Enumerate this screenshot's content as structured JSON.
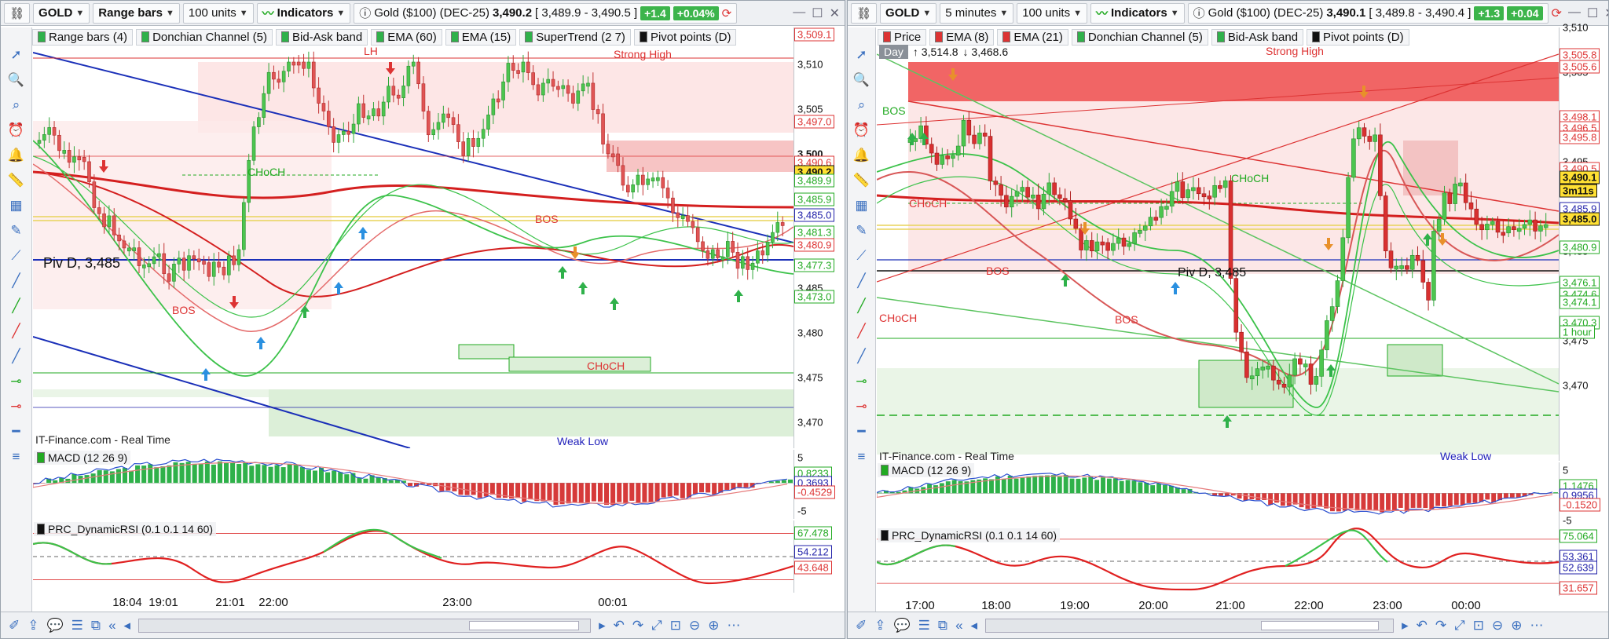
{
  "left": {
    "toolbar": {
      "symbol": "GOLD",
      "chart_type": "Range bars",
      "units": "100 units",
      "indicators_label": "Indicators",
      "instrument": "Gold ($100) (DEC-25)",
      "last": "3,490.2",
      "bidask": "[ 3,489.9 - 3,490.5 ]",
      "change": "+1.4",
      "change_pct": "+0.04%"
    },
    "legend": [
      {
        "label": "Range bars (4)",
        "color": "#2fb14a"
      },
      {
        "label": "Donchian Channel (5)",
        "color": "#2fb14a"
      },
      {
        "label": "Bid-Ask band",
        "color": "#2fb14a"
      },
      {
        "label": "EMA (60)",
        "color": "#2fb14a"
      },
      {
        "label": "EMA (15)",
        "color": "#2fb14a"
      },
      {
        "label": "SuperTrend (2 7)",
        "color": "#2fb14a"
      },
      {
        "label": "Pivot points (D)",
        "color": "#111111"
      }
    ],
    "price_axis": [
      "3,510",
      "3,505",
      "3,500",
      "3,495",
      "3,490",
      "3,485",
      "3,480",
      "3,475",
      "3,470"
    ],
    "price_tags": [
      {
        "text": "3,509.1",
        "color": "#d33"
      },
      {
        "text": "3,497.0",
        "color": "#d33"
      },
      {
        "text": "3,490.6",
        "color": "#d33"
      },
      {
        "text": "3,490.2",
        "color": "#111"
      },
      {
        "text": "3,489.9",
        "color": "#2a2"
      },
      {
        "text": "3,485.9",
        "color": "#2a2"
      },
      {
        "text": "3,485.0",
        "color": "#22a"
      },
      {
        "text": "3,481.3",
        "color": "#2a2"
      },
      {
        "text": "3,480.9",
        "color": "#d33"
      },
      {
        "text": "3,477.3",
        "color": "#2a2"
      },
      {
        "text": "3,473.0",
        "color": "#2a2"
      }
    ],
    "annotations": {
      "strong_high": "Strong High",
      "weak_low": "Weak Low",
      "lh": "LH",
      "choch1": "CHoCH",
      "choch2": "CHoCH",
      "bos1": "BOS",
      "bos2": "BOS",
      "pivot": "Piv D, 3,485",
      "vendor": "IT-Finance.com - Real Time"
    },
    "macd": {
      "label": "MACD (12 26 9)",
      "axis": [
        "5",
        "-5"
      ],
      "tags": [
        "0.8233",
        "0.3693",
        "-0.4529"
      ]
    },
    "rsi": {
      "label": "PRC_DynamicRSI (0.1 0.1 14 60)",
      "tags": [
        "67.478",
        "54.212",
        "43.648"
      ]
    },
    "time_axis": [
      "18:04",
      "19:01",
      "21:01",
      "22:00",
      "23:00",
      "00:01"
    ]
  },
  "right": {
    "toolbar": {
      "symbol": "GOLD",
      "timeframe": "5 minutes",
      "units": "100 units",
      "indicators_label": "Indicators",
      "instrument": "Gold ($100) (DEC-25)",
      "last": "3,490.1",
      "bidask": "[ 3,489.8 - 3,490.4 ]",
      "change": "+1.3",
      "change_pct": "+0.04"
    },
    "legend": [
      {
        "label": "Price",
        "color": "#d33"
      },
      {
        "label": "EMA (8)",
        "color": "#d33"
      },
      {
        "label": "EMA (21)",
        "color": "#d33"
      },
      {
        "label": "Donchian Channel (5)",
        "color": "#2fb14a"
      },
      {
        "label": "Bid-Ask band",
        "color": "#2fb14a"
      },
      {
        "label": "Pivot points (D)",
        "color": "#111111"
      }
    ],
    "day_badge": {
      "day": "Day",
      "high": "↑ 3,514.8",
      "low": "↓ 3,468.6"
    },
    "price_axis": [
      "3,510",
      "3,505",
      "3,500",
      "3,495",
      "3,490",
      "3,485",
      "3,480",
      "3,475",
      "3,470"
    ],
    "price_tags": [
      {
        "text": "3,505.8",
        "color": "#d33"
      },
      {
        "text": "3,505.6",
        "color": "#d33"
      },
      {
        "text": "3,498.1",
        "color": "#d33"
      },
      {
        "text": "3,496.5",
        "color": "#d33"
      },
      {
        "text": "3,495.8",
        "color": "#d33"
      },
      {
        "text": "3,490.5",
        "color": "#d33"
      },
      {
        "text": "3,490.1",
        "color": "#111"
      },
      {
        "text": "3m11s",
        "color": "#111"
      },
      {
        "text": "3,485.9",
        "color": "#22a"
      },
      {
        "text": "3,485.0",
        "color": "#111"
      },
      {
        "text": "3,480.9",
        "color": "#2a2"
      },
      {
        "text": "3,476.1",
        "color": "#2a2"
      },
      {
        "text": "3,474.6",
        "color": "#2a2"
      },
      {
        "text": "3,474.1",
        "color": "#2a2"
      },
      {
        "text": "3,470.3",
        "color": "#2a2"
      },
      {
        "text": "1 hour",
        "color": "#2a2"
      }
    ],
    "annotations": {
      "strong_high": "Strong High",
      "weak_low": "Weak Low",
      "bos1": "BOS",
      "bos2": "BOS",
      "bos3": "BOS",
      "choch1": "CHoCH",
      "choch2": "CHoCH",
      "choch3": "CHoCH",
      "pivot": "Piv D, 3,485",
      "vendor": "IT-Finance.com - Real Time"
    },
    "macd": {
      "label": "MACD (12 26 9)",
      "axis": [
        "5",
        "-5"
      ],
      "tags": [
        "1.1476",
        "0.9956",
        "-0.1520"
      ]
    },
    "rsi": {
      "label": "PRC_DynamicRSI (0.1 0.1 14 60)",
      "tags": [
        "75.064",
        "53.361",
        "52.639",
        "31.657"
      ]
    },
    "time_axis": [
      "17:00",
      "18:00",
      "19:00",
      "20:00",
      "21:00",
      "22:00",
      "23:00",
      "00:00"
    ]
  }
}
